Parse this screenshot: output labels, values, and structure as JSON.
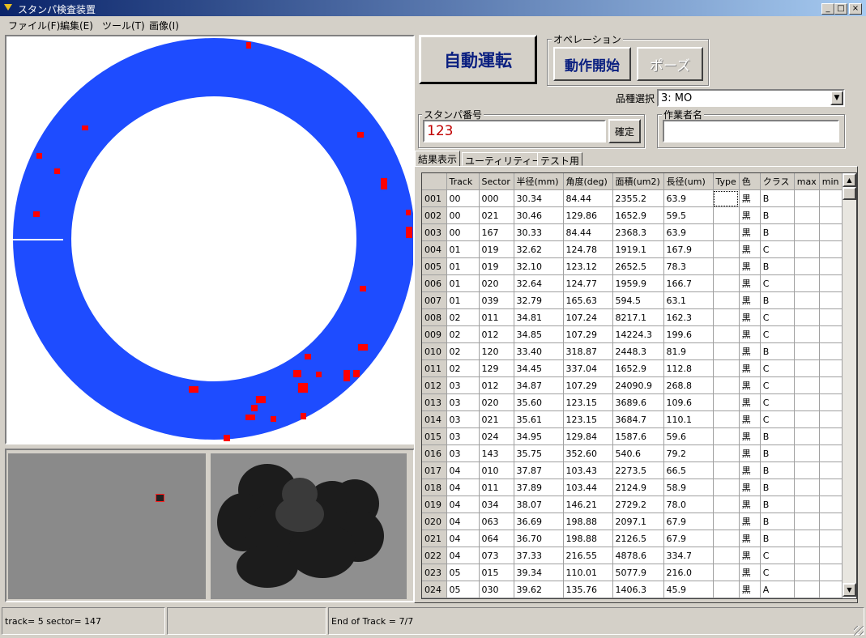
{
  "window": {
    "title": "スタンパ検査装置",
    "buttons": {
      "minimize": "_",
      "maximize": "□",
      "close": "×"
    }
  },
  "menu": [
    "ファイル(F)",
    "編集(E)",
    "ツール(T)",
    "画像(I)"
  ],
  "buttons": {
    "auto": "自動運転",
    "start": "動作開始",
    "pause": "ポーズ",
    "confirm": "確定"
  },
  "operation_label": "オペレーション",
  "product": {
    "label": "品種選択",
    "value": "3: MO"
  },
  "stamper": {
    "label": "スタンパ番号",
    "value": "123"
  },
  "operator": {
    "label": "作業者名",
    "value": ""
  },
  "tabs": [
    "結果表示",
    "ユーティリティー",
    "テスト用"
  ],
  "table": {
    "columns": [
      "",
      "Track",
      "Sector",
      "半径(mm)",
      "角度(deg)",
      "面積(um2)",
      "長径(um)",
      "Type",
      "色",
      "クラス",
      "max",
      "min"
    ],
    "rows": [
      [
        "001",
        "00",
        "000",
        "30.34",
        "84.44",
        "2355.2",
        "63.9",
        "",
        "黒",
        "B",
        "",
        ""
      ],
      [
        "002",
        "00",
        "021",
        "30.46",
        "129.86",
        "1652.9",
        "59.5",
        "",
        "黒",
        "B",
        "",
        ""
      ],
      [
        "003",
        "00",
        "167",
        "30.33",
        "84.44",
        "2368.3",
        "63.9",
        "",
        "黒",
        "B",
        "",
        ""
      ],
      [
        "004",
        "01",
        "019",
        "32.62",
        "124.78",
        "1919.1",
        "167.9",
        "",
        "黒",
        "C",
        "",
        ""
      ],
      [
        "005",
        "01",
        "019",
        "32.10",
        "123.12",
        "2652.5",
        "78.3",
        "",
        "黒",
        "B",
        "",
        ""
      ],
      [
        "006",
        "01",
        "020",
        "32.64",
        "124.77",
        "1959.9",
        "166.7",
        "",
        "黒",
        "C",
        "",
        ""
      ],
      [
        "007",
        "01",
        "039",
        "32.79",
        "165.63",
        "594.5",
        "63.1",
        "",
        "黒",
        "B",
        "",
        ""
      ],
      [
        "008",
        "02",
        "011",
        "34.81",
        "107.24",
        "8217.1",
        "162.3",
        "",
        "黒",
        "C",
        "",
        ""
      ],
      [
        "009",
        "02",
        "012",
        "34.85",
        "107.29",
        "14224.3",
        "199.6",
        "",
        "黒",
        "C",
        "",
        ""
      ],
      [
        "010",
        "02",
        "120",
        "33.40",
        "318.87",
        "2448.3",
        "81.9",
        "",
        "黒",
        "B",
        "",
        ""
      ],
      [
        "011",
        "02",
        "129",
        "34.45",
        "337.04",
        "1652.9",
        "112.8",
        "",
        "黒",
        "C",
        "",
        ""
      ],
      [
        "012",
        "03",
        "012",
        "34.87",
        "107.29",
        "24090.9",
        "268.8",
        "",
        "黒",
        "C",
        "",
        ""
      ],
      [
        "013",
        "03",
        "020",
        "35.60",
        "123.15",
        "3689.6",
        "109.6",
        "",
        "黒",
        "C",
        "",
        ""
      ],
      [
        "014",
        "03",
        "021",
        "35.61",
        "123.15",
        "3684.7",
        "110.1",
        "",
        "黒",
        "C",
        "",
        ""
      ],
      [
        "015",
        "03",
        "024",
        "34.95",
        "129.84",
        "1587.6",
        "59.6",
        "",
        "黒",
        "B",
        "",
        ""
      ],
      [
        "016",
        "03",
        "143",
        "35.75",
        "352.60",
        "540.6",
        "79.2",
        "",
        "黒",
        "B",
        "",
        ""
      ],
      [
        "017",
        "04",
        "010",
        "37.87",
        "103.43",
        "2273.5",
        "66.5",
        "",
        "黒",
        "B",
        "",
        ""
      ],
      [
        "018",
        "04",
        "011",
        "37.89",
        "103.44",
        "2124.9",
        "58.9",
        "",
        "黒",
        "B",
        "",
        ""
      ],
      [
        "019",
        "04",
        "034",
        "38.07",
        "146.21",
        "2729.2",
        "78.0",
        "",
        "黒",
        "B",
        "",
        ""
      ],
      [
        "020",
        "04",
        "063",
        "36.69",
        "198.88",
        "2097.1",
        "67.9",
        "",
        "黒",
        "B",
        "",
        ""
      ],
      [
        "021",
        "04",
        "064",
        "36.70",
        "198.88",
        "2126.5",
        "67.9",
        "",
        "黒",
        "B",
        "",
        ""
      ],
      [
        "022",
        "04",
        "073",
        "37.33",
        "216.55",
        "4878.6",
        "334.7",
        "",
        "黒",
        "C",
        "",
        ""
      ],
      [
        "023",
        "05",
        "015",
        "39.34",
        "110.01",
        "5077.9",
        "216.0",
        "",
        "黒",
        "C",
        "",
        ""
      ],
      [
        "024",
        "05",
        "030",
        "39.62",
        "135.76",
        "1406.3",
        "45.9",
        "",
        "黒",
        "A",
        "",
        ""
      ]
    ]
  },
  "status": [
    "track= 5 sector= 147",
    "",
    "End of Track = 7/7"
  ],
  "colors": {
    "disc": "#1e4cff",
    "defect": "#ff0000",
    "title_blue": "#0a246a",
    "stamper_text": "#c00000"
  }
}
